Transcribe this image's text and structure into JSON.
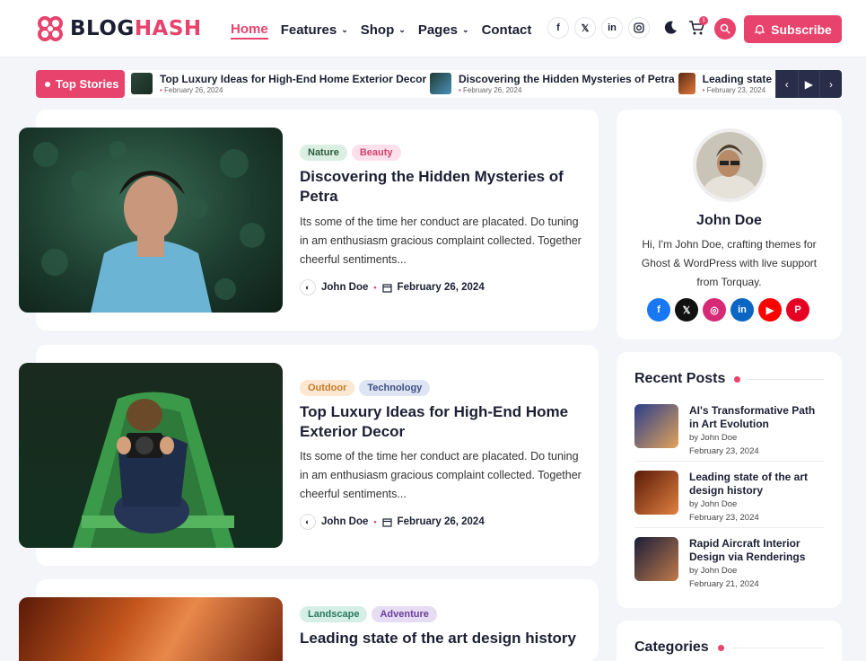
{
  "header": {
    "logo_first": "BLOG",
    "logo_second": "HASH",
    "nav": [
      {
        "label": "Home"
      },
      {
        "label": "Features"
      },
      {
        "label": "Shop"
      },
      {
        "label": "Pages"
      },
      {
        "label": "Contact"
      }
    ],
    "socials": [
      "facebook-icon",
      "x-icon",
      "linkedin-icon",
      "instagram-icon"
    ],
    "cart_count": "1",
    "subscribe_label": "Subscribe"
  },
  "ticker": {
    "label": "Top Stories",
    "items": [
      {
        "title": "Top Luxury Ideas for High-End Home Exterior Decor",
        "date": "February 26, 2024"
      },
      {
        "title": "Discovering the Hidden Mysteries of Petra",
        "date": "February 26, 2024"
      },
      {
        "title": "Leading state",
        "date": "February 23, 2024"
      }
    ]
  },
  "posts": [
    {
      "tags": [
        {
          "label": "Nature"
        },
        {
          "label": "Beauty"
        }
      ],
      "title": "Discovering the Hidden Mysteries of Petra",
      "excerpt": "Its some of the time her conduct are placated. Do tuning in am enthusiasm gracious complaint collected. Together cheerful sentiments...",
      "author": "John Doe",
      "date": "February 26, 2024"
    },
    {
      "tags": [
        {
          "label": "Outdoor"
        },
        {
          "label": "Technology"
        }
      ],
      "title": "Top Luxury Ideas for High-End Home Exterior Decor",
      "excerpt": "Its some of the time her conduct are placated. Do tuning in am enthusiasm gracious complaint collected. Together cheerful sentiments...",
      "author": "John Doe",
      "date": "February 26, 2024"
    },
    {
      "tags": [
        {
          "label": "Landscape"
        },
        {
          "label": "Adventure"
        }
      ],
      "title": "Leading state of the art design history"
    }
  ],
  "author_box": {
    "name": "John Doe",
    "bio": "Hi, I'm John Doe, crafting themes for Ghost & WordPress with live support from Torquay.",
    "socials": [
      "facebook-icon",
      "x-icon",
      "instagram-icon",
      "linkedin-icon",
      "youtube-icon",
      "pinterest-icon"
    ]
  },
  "recent_posts": {
    "title": "Recent Posts",
    "items": [
      {
        "title": "AI's Transformative Path in Art Evolution",
        "by": "by John Doe",
        "date": "February 23, 2024"
      },
      {
        "title": "Leading state of the art design history",
        "by": "by John Doe",
        "date": "February 23, 2024"
      },
      {
        "title": "Rapid Aircraft Interior Design via Renderings",
        "by": "by John Doe",
        "date": "February 21, 2024"
      }
    ]
  },
  "categories": {
    "title": "Categories"
  },
  "colors": {
    "accent": "#e8436c",
    "dark": "#1c1f33"
  }
}
